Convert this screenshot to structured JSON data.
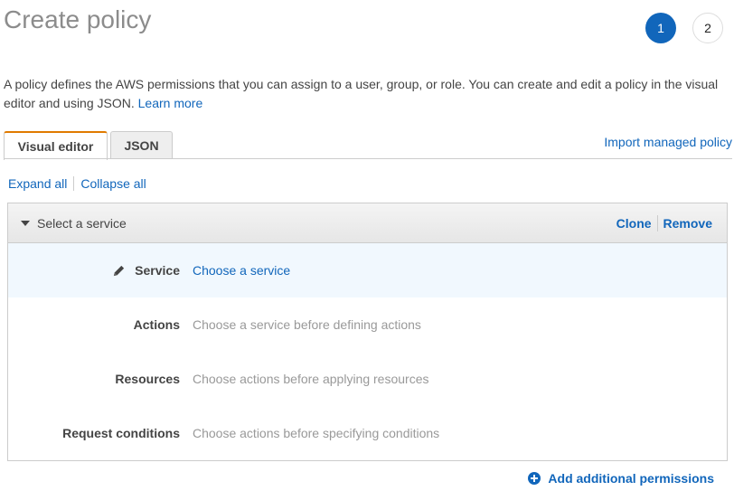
{
  "header": {
    "title": "Create policy",
    "steps": [
      {
        "label": "1",
        "active": true
      },
      {
        "label": "2",
        "active": false
      }
    ]
  },
  "description": {
    "text": "A policy defines the AWS permissions that you can assign to a user, group, or role. You can create and edit a policy in the visual editor and using JSON.",
    "learn_more": "Learn more"
  },
  "tabs": [
    {
      "label": "Visual editor",
      "active": true
    },
    {
      "label": "JSON",
      "active": false
    }
  ],
  "import_link": "Import managed policy",
  "expand_all": "Expand all",
  "collapse_all": "Collapse all",
  "panel": {
    "title": "Select a service",
    "clone": "Clone",
    "remove": "Remove",
    "rows": [
      {
        "label": "Service",
        "value": "Choose a service",
        "icon": "pencil-icon"
      },
      {
        "label": "Actions",
        "value": "Choose a service before defining actions"
      },
      {
        "label": "Resources",
        "value": "Choose actions before applying resources"
      },
      {
        "label": "Request conditions",
        "value": "Choose actions before specifying conditions"
      }
    ]
  },
  "add_permissions": "Add additional permissions",
  "colors": {
    "accent": "#1166bb",
    "tab_active_border": "#e07b00",
    "service_row_bg": "#f1f8fe"
  }
}
